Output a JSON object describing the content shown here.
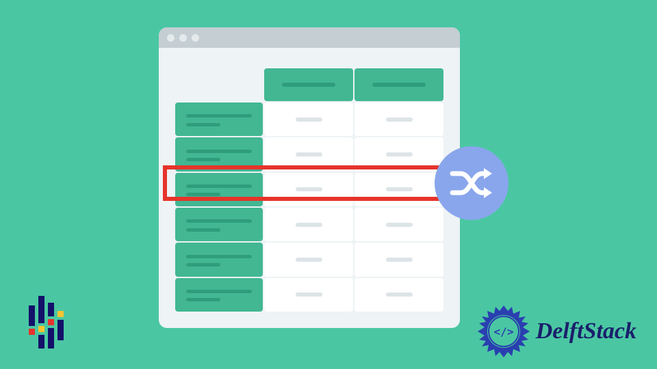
{
  "brand": {
    "name": "DelftStack"
  },
  "icons": {
    "shuffle": "shuffle-icon",
    "pandas": "pandas-logo-icon",
    "delft_badge": "delft-badge-icon"
  },
  "colors": {
    "bg": "#4ac7a2",
    "accent": "#42b792",
    "highlight": "#e6342b",
    "shuffle_bg": "#89a6ec",
    "brand_text": "#1a1f6b"
  },
  "table": {
    "header_cols": 2,
    "side_rows": 6,
    "highlighted_row_index": 2
  }
}
